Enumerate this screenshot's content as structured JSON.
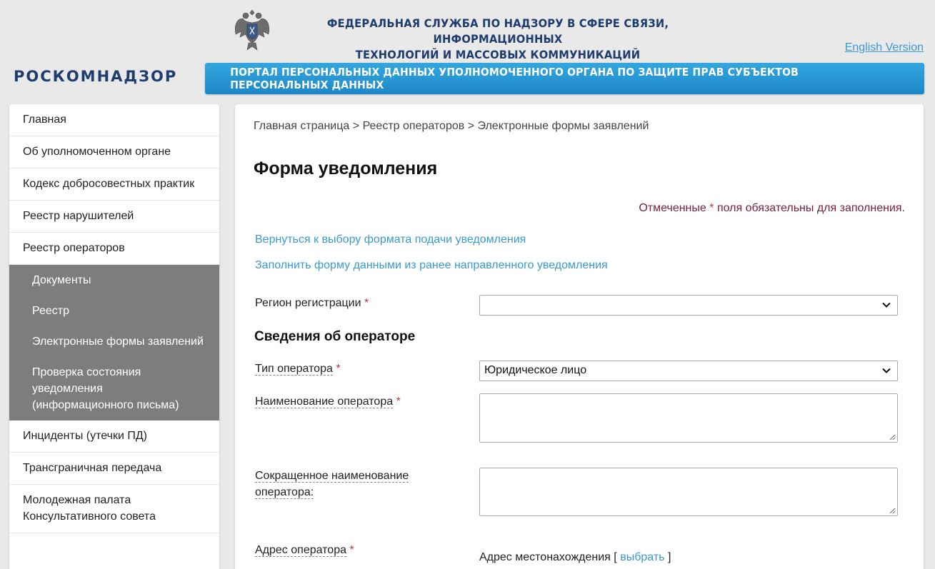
{
  "header": {
    "agency_line1": "ФЕДЕРАЛЬНАЯ СЛУЖБА ПО НАДЗОРУ В СФЕРЕ СВЯЗИ, ИНФОРМАЦИОННЫХ",
    "agency_line2": "ТЕХНОЛОГИЙ И МАССОВЫХ КОММУНИКАЦИЙ",
    "english_link": "English Version",
    "logo": "РОСКОМНАДЗОР",
    "portal_title": "ПОРТАЛ ПЕРСОНАЛЬНЫХ ДАННЫХ УПОЛНОМОЧЕННОГО ОРГАНА ПО ЗАЩИТЕ ПРАВ СУБЪЕКТОВ ПЕРСОНАЛЬНЫХ ДАННЫХ",
    "emblem_icon": "double-headed-eagle-emblem"
  },
  "sidebar": {
    "items": [
      {
        "label": "Главная"
      },
      {
        "label": "Об уполномоченном органе"
      },
      {
        "label": "Кодекс добросовестных практик"
      },
      {
        "label": "Реестр нарушителей"
      },
      {
        "label": "Реестр операторов"
      }
    ],
    "subitems": [
      {
        "label": "Документы"
      },
      {
        "label": "Реестр"
      },
      {
        "label": "Электронные формы заявлений"
      },
      {
        "label": "Проверка состояния уведомления (информационного письма)"
      }
    ],
    "items_after": [
      {
        "label": "Инциденты (утечки ПД)"
      },
      {
        "label": "Трансграничная передача"
      },
      {
        "label": "Молодежная палата Консультативного совета"
      }
    ]
  },
  "breadcrumb": {
    "home": "Главная страница",
    "registry": "Реестр операторов",
    "current": "Электронные формы заявлений",
    "separator": ">"
  },
  "form": {
    "title": "Форма уведомления",
    "required_note_before": "Отмеченные",
    "required_star": "*",
    "required_note_after": "поля обязательны для заполнения.",
    "link_back": "Вернуться к выбору формата подачи уведомления",
    "link_fill": "Заполнить форму данными из ранее направленного уведомления",
    "region_label": "Регион регистрации",
    "region_value": "",
    "section_operator": "Сведения об операторе",
    "operator_type_label": "Тип оператора",
    "operator_type_value": "Юридическое лицо",
    "operator_name_label": "Наименование оператора",
    "operator_name_value": "",
    "short_name_label": "Сокращенное наименование оператора:",
    "short_name_value": "",
    "address_label": "Адрес оператора",
    "address_location_label": "Адрес местонахождения",
    "address_pick_open": "[",
    "address_pick_link": "выбрать",
    "address_pick_close": "]"
  },
  "colors": {
    "brand_navy": "#1f3c6e",
    "portal_bar": "#1d87c9",
    "link": "#3a9ad0",
    "required": "#c0392b",
    "subnav_bg": "#7d7d7d"
  }
}
